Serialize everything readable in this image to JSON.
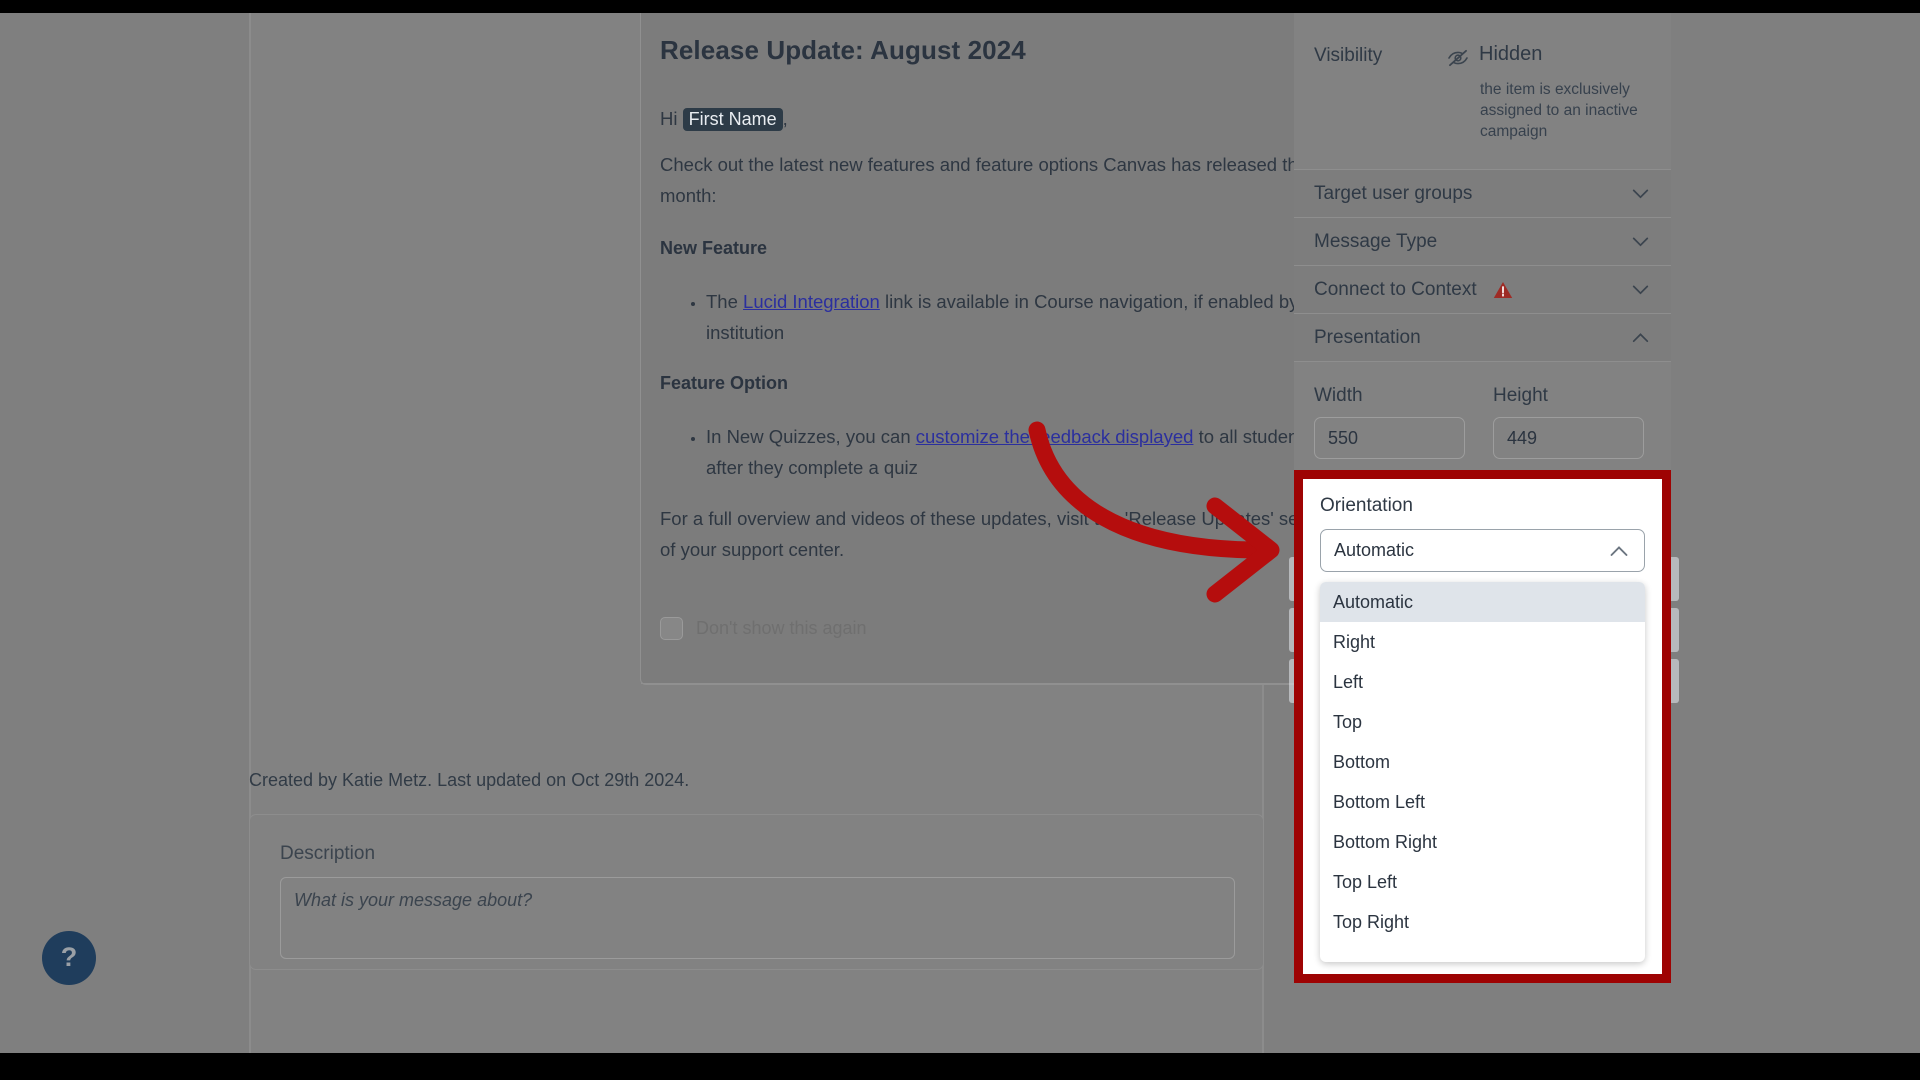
{
  "colors": {
    "overlay": "#7f7f7f",
    "annotation_red": "#9e0303",
    "link": "#2b2f9e",
    "accent_dark": "#2d3b47",
    "warning": "#9e2b25",
    "help_fab": "#1f3d5c"
  },
  "modal": {
    "title": "Release Update: August 2024",
    "close_icon": "close-icon",
    "greeting_prefix": "Hi ",
    "greeting_token": "First Name",
    "greeting_suffix": ",",
    "intro": "Check out the latest new features and feature options Canvas has released this month:",
    "section_new_feature": "New Feature",
    "bullet_new_feature_pre": "The ",
    "bullet_new_feature_link": "Lucid Integration",
    "bullet_new_feature_post": " link is available in Course navigation, if enabled by your institution",
    "section_feature_option": "Feature Option",
    "bullet_feature_option_pre": "In New Quizzes, you can ",
    "bullet_feature_option_link": "customize the feedback displayed",
    "bullet_feature_option_post": " to all students after they complete a quiz",
    "outro": "For a full overview and videos of these updates, visit the 'Release Updates' section of your support center.",
    "dont_show_label": "Don't show this again",
    "dont_show_checked": false
  },
  "page": {
    "created_by": "Created by Katie Metz. Last updated on Oct 29th 2024.",
    "description_label": "Description",
    "description_placeholder": "What is your message about?",
    "description_value": "",
    "help_icon": "question-mark-icon"
  },
  "sidebar": {
    "visibility": {
      "label": "Visibility",
      "icon": "eye-slash-icon",
      "value": "Hidden",
      "note": "the item is exclusively assigned to an inactive campaign"
    },
    "accordions": [
      {
        "label": "Target user groups",
        "expanded": false,
        "chevron": "chevron-down-icon",
        "warning": false
      },
      {
        "label": "Message Type",
        "expanded": false,
        "chevron": "chevron-down-icon",
        "warning": false
      },
      {
        "label": "Connect to Context",
        "expanded": false,
        "chevron": "chevron-down-icon",
        "warning": true,
        "warning_icon": "warning-triangle-icon"
      },
      {
        "label": "Presentation",
        "expanded": true,
        "chevron": "chevron-up-icon",
        "warning": false
      }
    ],
    "presentation": {
      "width_label": "Width",
      "width_value": "550",
      "height_label": "Height",
      "height_value": "449"
    }
  },
  "orientation": {
    "label": "Orientation",
    "selected": "Automatic",
    "chevron": "chevron-up-icon",
    "expanded": true,
    "options": [
      "Automatic",
      "Right",
      "Left",
      "Top",
      "Bottom",
      "Bottom Left",
      "Bottom Right",
      "Top Left",
      "Top Right"
    ]
  },
  "annotation": {
    "arrow": "curved-arrow-right",
    "color": "#9e0303"
  }
}
